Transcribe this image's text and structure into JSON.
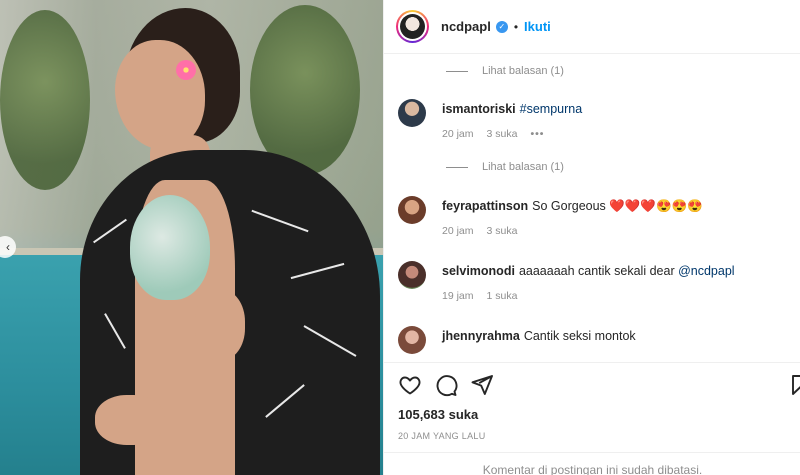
{
  "post": {
    "username": "ncdpapl",
    "follow_label": "Ikuti",
    "separator": "•",
    "likes": "105,683 suka",
    "timestamp": "20 JAM YANG LALU",
    "comments_closed": "Komentar di postingan ini sudah dibatasi."
  },
  "replies_label": "Lihat balasan (1)",
  "comments": [
    {
      "user": "ismantoriski",
      "text": "#sempurna",
      "link": true,
      "time": "20 jam",
      "likes": "3 suka",
      "more": "•••"
    },
    {
      "user": "feyrapattinson",
      "text": "So Gorgeous ❤️❤️❤️😍😍😍",
      "link": false,
      "time": "20 jam",
      "likes": "3 suka"
    },
    {
      "user": "selvimonodi",
      "text": "aaaaaaah cantik sekali dear ",
      "mention": "@ncdpapl",
      "time": "19 jam",
      "likes": "1 suka"
    },
    {
      "user": "jhennyrahma",
      "text": "Cantik seksi montok"
    }
  ],
  "icons": [
    "heart-icon",
    "comment-icon",
    "share-icon",
    "bookmark-icon",
    "chevron-left-icon",
    "verified-icon"
  ],
  "colors": {
    "accent": "#0095f6",
    "verified": "#3897f0",
    "muted": "#8e8e8e",
    "text": "#262626"
  }
}
